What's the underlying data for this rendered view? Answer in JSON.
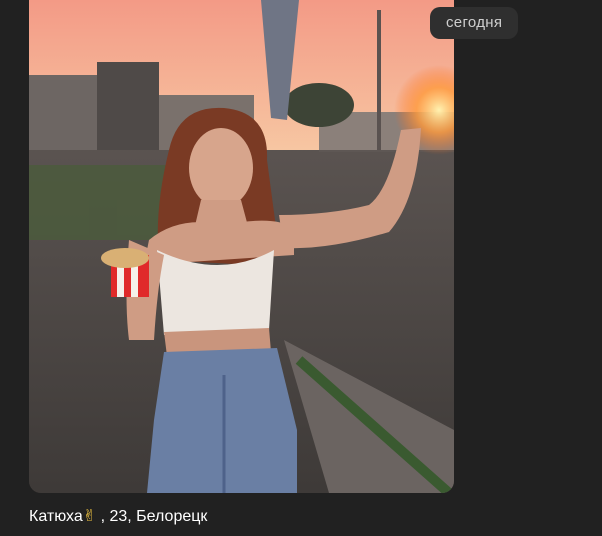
{
  "chat": {
    "date_separator": "сегодня"
  },
  "message": {
    "caption_name": "Катюха",
    "caption_emoji": "✌",
    "caption_rest": " , 23, Белорецк",
    "photo_icon": "photo-portrait"
  },
  "colors": {
    "background": "#212121",
    "date_chip": "#2f2f2f",
    "caption_text": "#ffffff",
    "sky_top": "#f4a58c",
    "sky_bottom": "#f6c2a0",
    "ground": "#4a4644"
  }
}
